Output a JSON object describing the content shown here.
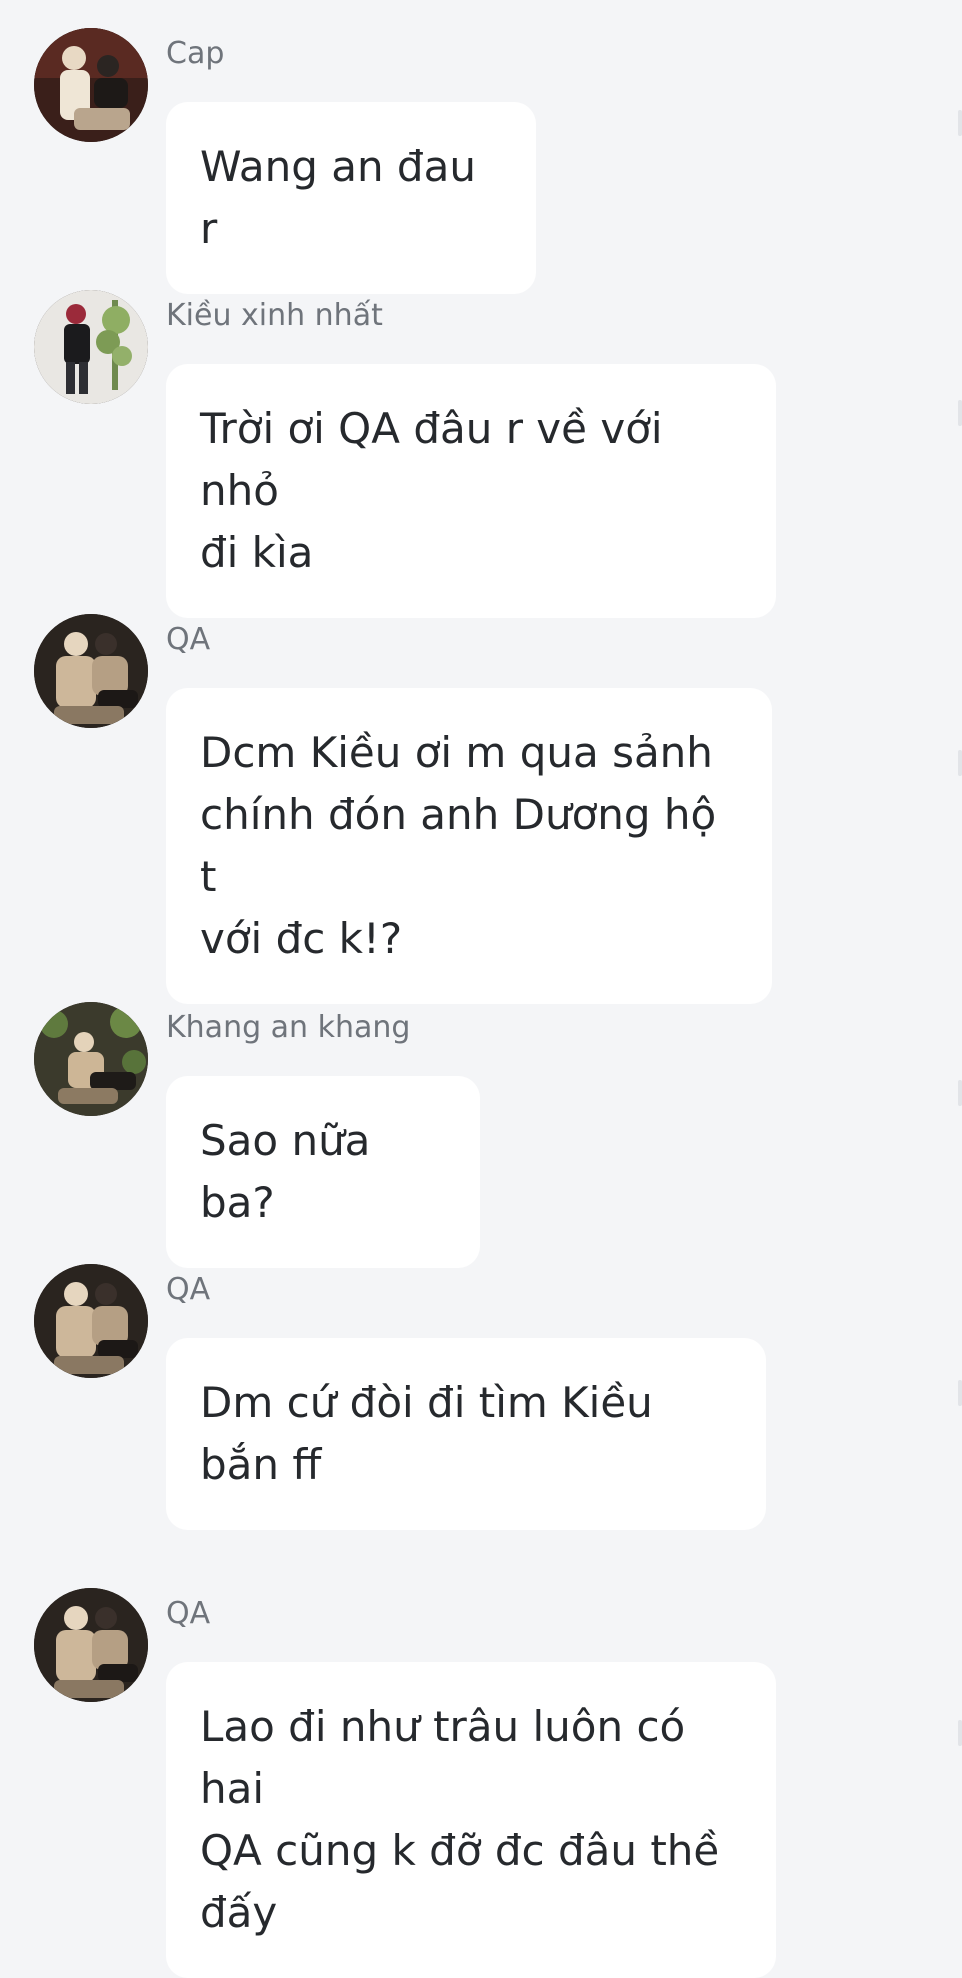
{
  "messages": [
    {
      "sender": "Cap",
      "text": "Wang an đau r",
      "avatar": "avatar-cap"
    },
    {
      "sender": "Kiều xinh nhất",
      "text": "Trời ơi QA đâu r về với nhỏ\nđi kìa",
      "avatar": "avatar-kieu"
    },
    {
      "sender": "QA",
      "text": "Dcm Kiều ơi m qua sảnh\nchính đón anh Dương hộ t\nvới đc k!?",
      "avatar": "avatar-qa"
    },
    {
      "sender": "Khang an khang",
      "text": "Sao nữa ba?",
      "avatar": "avatar-khang"
    },
    {
      "sender": "QA",
      "text": "Dm cứ đòi đi tìm Kiều\nbắn ff",
      "avatar": "avatar-qa"
    },
    {
      "sender": "QA",
      "text": "Lao đi như trâu luôn có hai\nQA cũng k đỡ đc đâu thề\nđấy",
      "avatar": "avatar-qa"
    }
  ],
  "colors": {
    "background": "#f4f5f7",
    "bubble": "#ffffff",
    "text": "#26292d",
    "sender": "#6f747b"
  }
}
